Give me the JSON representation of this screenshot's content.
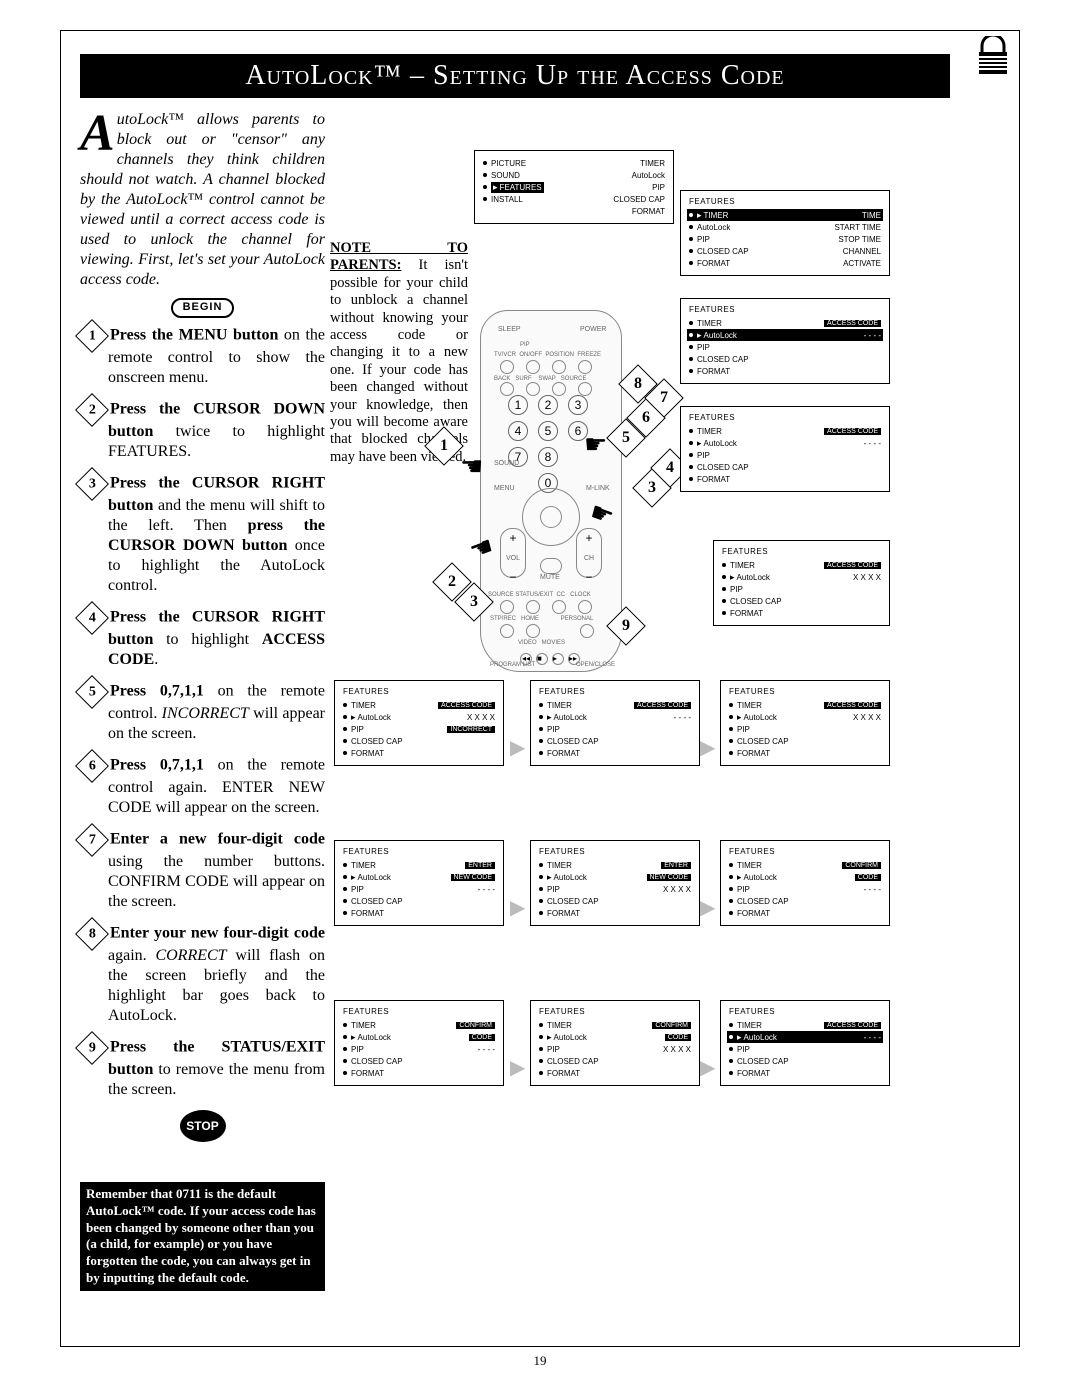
{
  "title": "AutoLock™ – Setting Up the Access Code",
  "intro": "utoLock™ allows parents to block out or \"censor\" any channels they think children should not watch. A channel blocked by the AutoLock™ control cannot be viewed until a correct access code is used to unlock the channel for viewing. First, let's set your AutoLock access code.",
  "begin": "BEGIN",
  "stop": "STOP",
  "steps": [
    {
      "n": "1",
      "bold": "Press the MENU button",
      "rest": " on the remote control to show the onscreen menu."
    },
    {
      "n": "2",
      "bold": "Press the CURSOR DOWN button",
      "rest": " twice to highlight FEATURES."
    },
    {
      "n": "3",
      "bold": "Press the CURSOR RIGHT button",
      "rest": " and the menu will shift to the left. Then press the CURSOR DOWN button once to highlight the AutoLock control."
    },
    {
      "n": "4",
      "bold": "Press the CURSOR RIGHT button",
      "rest": " to highlight ACCESS CODE."
    },
    {
      "n": "5",
      "bold": "Press 0,7,1,1",
      "rest": " on the remote control. INCORRECT will appear on the screen."
    },
    {
      "n": "6",
      "bold": "Press 0,7,1,1",
      "rest": " on the remote control again. ENTER NEW CODE will appear on the screen."
    },
    {
      "n": "7",
      "bold": "Enter a new four-digit code",
      "rest": " using the number buttons. CONFIRM CODE will appear on the screen."
    },
    {
      "n": "8",
      "bold": "Enter your new four-digit code",
      "rest": " again. CORRECT will flash on the screen briefly and the highlight bar goes back to AutoLock."
    },
    {
      "n": "9",
      "bold": "Press the STATUS/EXIT button",
      "rest": " to remove the menu from the screen."
    }
  ],
  "remember": "Remember that 0711 is the default AutoLock™ code. If your access code has been changed by someone other than you (a child, for example) or you have forgotten the code, you can always get in by inputting the default code.",
  "note_hd": "NOTE TO PARENTS:",
  "note_body": "It isn't possible for your child to unblock a channel without knowing your access code or changing it to a new one. If your code has been changed without your knowledge, then you will become aware that blocked channels may have been viewed.",
  "remote_rows_top": [
    "SLEEP",
    "POWER"
  ],
  "remote_rows_small": [
    "TV/VCR",
    "ON/OFF",
    "POSITION",
    "FREEZE",
    "BACK",
    "SURF",
    "SWAP",
    "SOURCE"
  ],
  "remote_labels": {
    "menu": "MENU",
    "mlink": "M-LINK",
    "sound": "SOUND",
    "mute": "MUTE",
    "vol": "VOL",
    "ch": "CH",
    "status": "STATUS/EXIT",
    "cc": "CC",
    "clock": "CLOCK",
    "home": "HOME",
    "personal": "PERSONAL",
    "video": "VIDEO",
    "movies": "MOVIES",
    "proglist": "PROGRAM LIST",
    "open": "OPEN/CLOSE"
  },
  "markers": [
    "1",
    "2",
    "3",
    "3",
    "4",
    "5",
    "6",
    "7",
    "8",
    "9"
  ],
  "menu1": {
    "left": [
      "PICTURE",
      "SOUND",
      "FEATURES",
      "INSTALL"
    ],
    "right": [
      "TIMER",
      "AutoLock",
      "PIP",
      "CLOSED CAP",
      "FORMAT"
    ],
    "hl": "FEATURES"
  },
  "menu2": {
    "hd": "FEATURES",
    "hl": "TIMER",
    "rows": [
      [
        "TIMER",
        "TIME"
      ],
      [
        "AutoLock",
        "START TIME"
      ],
      [
        "PIP",
        "STOP TIME"
      ],
      [
        "CLOSED CAP",
        "CHANNEL"
      ],
      [
        "FORMAT",
        "ACTIVATE"
      ]
    ]
  },
  "menu3": {
    "hd": "FEATURES",
    "hl": "AutoLock",
    "rows": [
      [
        "TIMER",
        "ACCESS CODE"
      ],
      [
        "AutoLock",
        "- - - -"
      ],
      [
        "PIP",
        ""
      ],
      [
        "CLOSED CAP",
        ""
      ],
      [
        "FORMAT",
        ""
      ]
    ]
  },
  "menu4": {
    "hd": "FEATURES",
    "badge": "ACCESS CODE",
    "sub": "- - - -",
    "rows": [
      "TIMER",
      "AutoLock",
      "PIP",
      "CLOSED CAP",
      "FORMAT"
    ]
  },
  "menu5": {
    "hd": "FEATURES",
    "badge": "ACCESS CODE",
    "sub": "X X X X",
    "rows": [
      "TIMER",
      "AutoLock",
      "PIP",
      "CLOSED CAP",
      "FORMAT"
    ]
  },
  "bottom_row1": [
    {
      "hd": "FEATURES",
      "badge": "ACCESS CODE",
      "sub": "X X X X",
      "sub2": "INCORRECT",
      "rows": [
        "TIMER",
        "AutoLock",
        "PIP",
        "CLOSED CAP",
        "FORMAT"
      ]
    },
    {
      "hd": "FEATURES",
      "badge": "ACCESS CODE",
      "sub": "- - - -",
      "rows": [
        "TIMER",
        "AutoLock",
        "PIP",
        "CLOSED CAP",
        "FORMAT"
      ]
    },
    {
      "hd": "FEATURES",
      "badge": "ACCESS CODE",
      "sub": "X X X X",
      "rows": [
        "TIMER",
        "AutoLock",
        "PIP",
        "CLOSED CAP",
        "FORMAT"
      ]
    }
  ],
  "bottom_row2": [
    {
      "hd": "FEATURES",
      "badge": "ENTER",
      "badge2": "NEW CODE",
      "sub": "- - - -",
      "rows": [
        "TIMER",
        "AutoLock",
        "PIP",
        "CLOSED CAP",
        "FORMAT"
      ]
    },
    {
      "hd": "FEATURES",
      "badge": "ENTER",
      "badge2": "NEW CODE",
      "sub": "X X X X",
      "rows": [
        "TIMER",
        "AutoLock",
        "PIP",
        "CLOSED CAP",
        "FORMAT"
      ]
    },
    {
      "hd": "FEATURES",
      "badge": "CONFIRM",
      "badge2": "CODE",
      "sub": "- - - -",
      "rows": [
        "TIMER",
        "AutoLock",
        "PIP",
        "CLOSED CAP",
        "FORMAT"
      ]
    }
  ],
  "bottom_row3": [
    {
      "hd": "FEATURES",
      "badge": "CONFIRM",
      "badge2": "CODE",
      "sub": "- - - -",
      "rows": [
        "TIMER",
        "AutoLock",
        "PIP",
        "CLOSED CAP",
        "FORMAT"
      ]
    },
    {
      "hd": "FEATURES",
      "badge": "CONFIRM",
      "badge2": "CODE",
      "sub": "X X X X",
      "rows": [
        "TIMER",
        "AutoLock",
        "PIP",
        "CLOSED CAP",
        "FORMAT"
      ]
    },
    {
      "hd": "FEATURES",
      "badge": "ACCESS CODE",
      "sub": "- - - -",
      "hl": "AutoLock",
      "rows": [
        "TIMER",
        "AutoLock",
        "PIP",
        "CLOSED CAP",
        "FORMAT"
      ]
    }
  ],
  "pagenum": "19"
}
